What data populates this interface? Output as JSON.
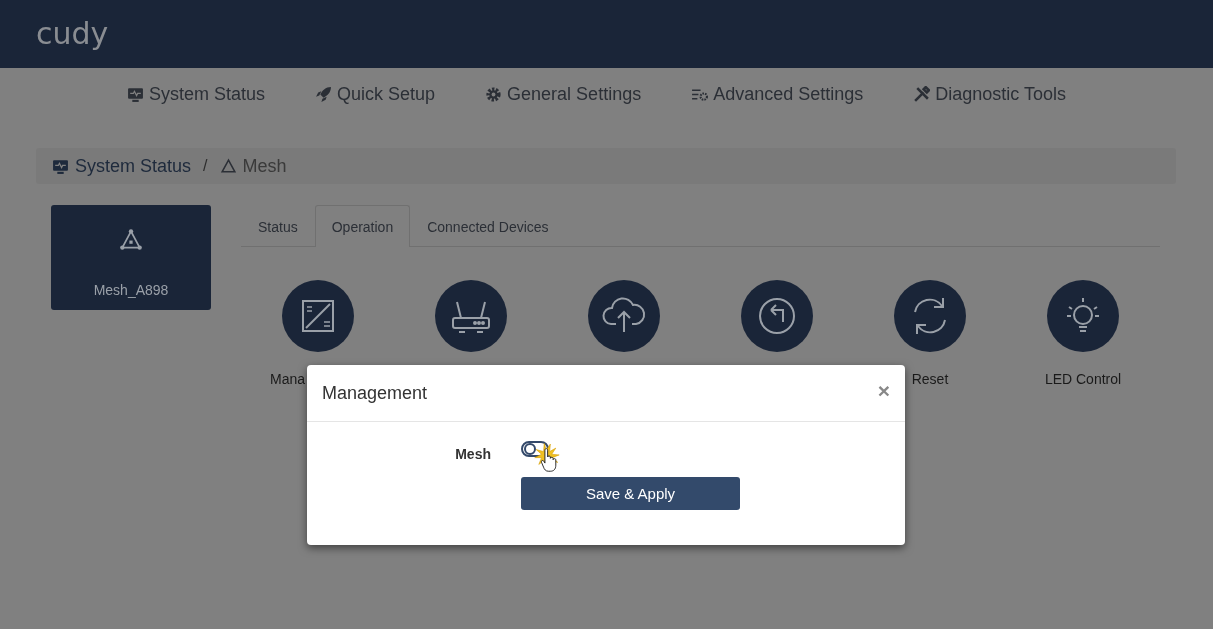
{
  "logo": "cudy",
  "nav": [
    {
      "label": "System Status"
    },
    {
      "label": "Quick Setup"
    },
    {
      "label": "General Settings"
    },
    {
      "label": "Advanced Settings"
    },
    {
      "label": "Diagnostic Tools"
    }
  ],
  "breadcrumb": [
    {
      "label": "System Status"
    },
    {
      "label": "Mesh"
    }
  ],
  "breadcrumb_separator": "/",
  "device": {
    "name": "Mesh_A898",
    "selected": true
  },
  "tabs": [
    {
      "label": "Status",
      "selected": false
    },
    {
      "label": "Operation",
      "selected": true
    },
    {
      "label": "Connected Devices",
      "selected": false
    }
  ],
  "operations": [
    {
      "kind": "labeled",
      "label": "Mana"
    },
    {
      "kind": "icon_only"
    },
    {
      "kind": "icon_only"
    },
    {
      "kind": "icon_only"
    },
    {
      "kind": "labeled",
      "label": "Reset"
    },
    {
      "kind": "labeled",
      "label": "LED Control"
    }
  ],
  "modal": {
    "title": "Management",
    "close": "×",
    "field_label": "Mesh",
    "toggle_on": false,
    "button": "Save & Apply"
  }
}
